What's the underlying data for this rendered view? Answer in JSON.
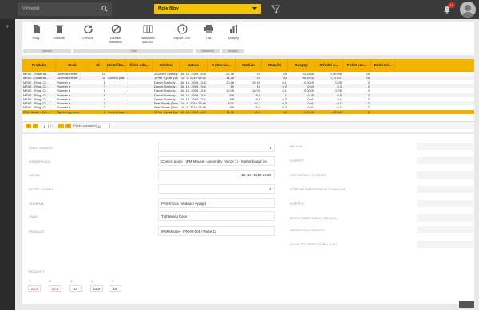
{
  "search": {
    "placeholder": "Vyhledat"
  },
  "filter": {
    "label": "Moje filtry"
  },
  "notifications": {
    "count": "16"
  },
  "toolbar": {
    "buttons": [
      "Nový",
      "Smazat",
      "Obnovit",
      "Zobrazit neaktivní",
      "Nastavení sloupců",
      "Export CSV",
      "Tisk",
      "Analýzy"
    ],
    "groups": [
      "Záznam",
      "Data",
      "Nastavení",
      "Analýzy"
    ]
  },
  "grid": {
    "columns": [
      "Produkt",
      "Znak",
      "Id",
      "Identifika...",
      "Číslo odb...",
      "Odebral",
      "Datum",
      "Aritmetic...",
      "Medián",
      "Rozpětí",
      "Rozptyl",
      "Střední s...",
      "Počet vzo...",
      "Dolní tol..."
    ],
    "rows": [
      [
        "MFA2 - Shaft as...",
        "Outer diameter ...",
        "10",
        "",
        "-",
        "2 Daniel Szekely ...",
        "16. 10. 2019 16:58",
        "22,46",
        "22",
        "25",
        "43,2896",
        "6,57948",
        "25"
      ],
      [
        "MFA2 - Shaft as...",
        "Outer diameter ...",
        "11",
        "Control plans -",
        "-",
        "1 Petr Kyzas (Ved...",
        "18. 9. 2019 09:22",
        "14,26",
        "10",
        "33",
        "95,4016",
        "9,76737",
        "25"
      ],
      [
        "MFA2 - Ring, O...",
        "Rozměr a",
        "8",
        "",
        "-",
        "Daniel Szekely ...",
        "16. 10. 2019 13:45",
        "10,48",
        "10,45",
        "0,1",
        "0,0025",
        "0,05",
        "2"
      ],
      [
        "MFA2 - Ring, O...",
        "Rozměr a",
        "7",
        "",
        "-",
        "Daniel Szekely ...",
        "16. 10. 2019 13:44",
        "10",
        "10",
        "0,2",
        "0,04",
        "0,2",
        "2"
      ],
      [
        "MFA2 - Ring, O...",
        "Rozměr a",
        "6",
        "",
        "-",
        "Daniel Szekely ...",
        "16. 10. 2019 13:44",
        "10,05",
        "10,05",
        "0,1",
        "0,0025",
        "0,05",
        "2"
      ],
      [
        "MFA2 - Ring, O...",
        "Rozměr a",
        "5",
        "",
        "-",
        "Daniel Szekely ...",
        "16. 10. 2019 13:44",
        "8,5",
        "8,5",
        "1",
        "0,25",
        "0,5",
        "2"
      ],
      [
        "MFA2 - Ring, O...",
        "Rozměr a",
        "4",
        "",
        "-",
        "Daniel Szekely ...",
        "16. 10. 2019 13:44",
        "9,9",
        "9,9",
        "0,2",
        "0,01",
        "0,1",
        "2"
      ],
      [
        "MFA2 - Ring, O...",
        "Rozměr a",
        "3",
        "",
        "-",
        "Petr Sunek (Prod...",
        "18. 9. 2019 13:46",
        "10,1",
        "10,1",
        "0,2",
        "0,01",
        "0,1",
        "2"
      ],
      [
        "MFA2 - Ring, O...",
        "Rozměr a",
        "2",
        "",
        "-",
        "Petr Sunek (Prod...",
        "18. 9. 2019 13:46",
        "9,6",
        "9,6",
        "0,2",
        "0,01",
        "0,1",
        "2"
      ],
      [
        "IPM Mouse - (Ve...",
        "Tightening force",
        "9",
        "Control plans - I...",
        "-",
        "1 Petr Kyzas (Ved...",
        "16. 10. 2019 14:25",
        "14,46",
        "14,5",
        "3,5",
        "1,1096",
        "1,09068",
        "5"
      ]
    ]
  },
  "pager": {
    "page": "1",
    "of": "/ 1",
    "count_label": "Počet záznamů",
    "count": "10"
  },
  "detail": {
    "labels_left": [
      "Číslo odběru",
      "Identifikace",
      "Datum",
      "Počet vzorků",
      "Odebral",
      "Znak",
      "Produkt"
    ],
    "values_left": [
      "1",
      "Control plans - IPM Mouse - Assembly (Verze 1) - Motherboard ee",
      "16. 10. 2019 14:25",
      "5",
      "Petr Kyzas (Vedoucí vývoje)",
      "Tightening force",
      "IPM Mouse - IPM-M-001 (Verze 1)"
    ],
    "labels_right": [
      "Medián",
      "Rozpětí",
      "Aritmetický průměr",
      "Střední směrodatná odchylka",
      "Rozptyl",
      "Horní toleranční mez (USL)",
      "Jmenovitá hodnota",
      "Dolní toleranční mez (LSL)"
    ],
    "hodnoty_label": "Hodnoty",
    "hodnoty_idx": [
      "1",
      "2",
      "3",
      "4",
      "5"
    ],
    "hodnoty": [
      "16,1",
      "12,8",
      "14",
      "14,5",
      "15"
    ]
  }
}
